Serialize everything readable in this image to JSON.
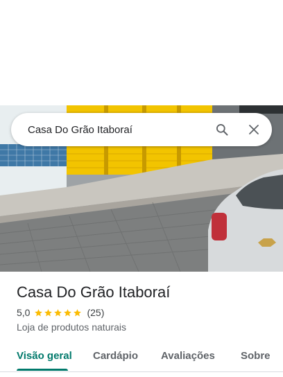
{
  "search": {
    "query": "Casa Do Grão Itaboraí"
  },
  "icons": {
    "search": "search-icon",
    "close": "close-icon",
    "star": "star-icon"
  },
  "place": {
    "name": "Casa Do Grão Itaboraí",
    "rating": "5,0",
    "stars": 5,
    "review_count": "(25)",
    "category": "Loja de produtos naturais"
  },
  "tabs": [
    {
      "label": "Visão geral",
      "active": true
    },
    {
      "label": "Cardápio",
      "active": false
    },
    {
      "label": "Avaliações",
      "active": false
    },
    {
      "label": "Sobre",
      "active": false
    }
  ],
  "colors": {
    "accent": "#00796b",
    "star": "#fbbc04"
  }
}
